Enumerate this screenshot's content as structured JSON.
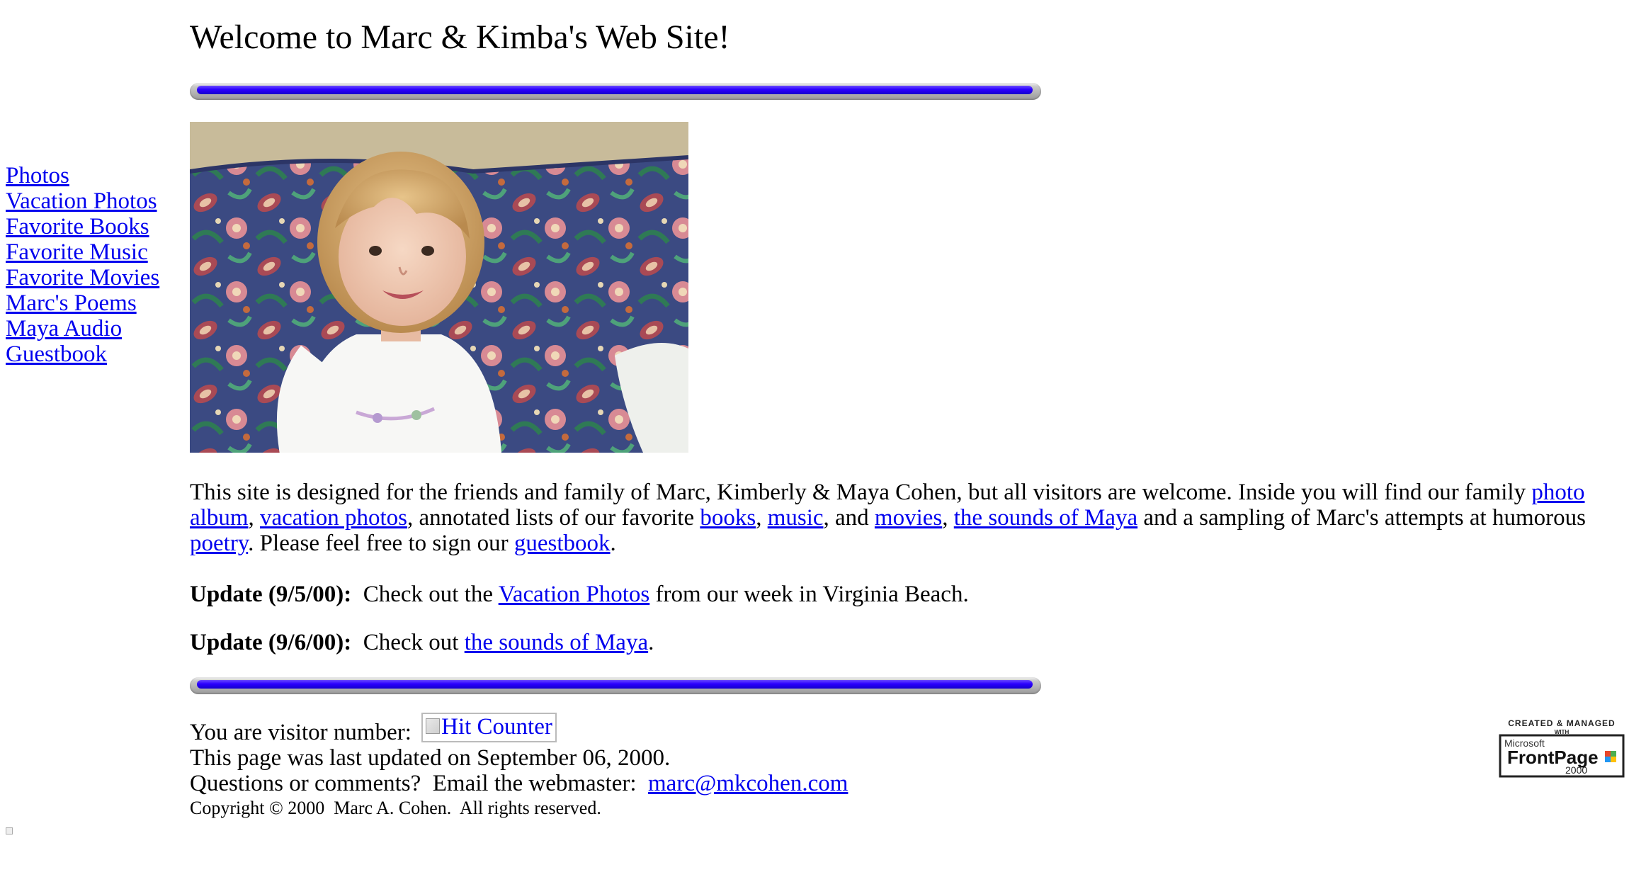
{
  "title": "Welcome to Marc & Kimba's Web Site!",
  "nav": {
    "items": [
      "Photos",
      "Vacation Photos",
      "Favorite Books",
      "Favorite Music",
      "Favorite Movies",
      "Marc's Poems",
      "Maya Audio",
      "Guestbook"
    ]
  },
  "intro": {
    "t1": "This site is designed for the friends and family of Marc, Kimberly & Maya Cohen, but all visitors are welcome.  Inside you will find our family ",
    "link_photo_album": "photo album",
    "t2": ", ",
    "link_vacation_photos": "vacation photos",
    "t3": ", annotated lists of our favorite ",
    "link_books": "books",
    "t4": ", ",
    "link_music": "music",
    "t5": ", and ",
    "link_movies": "movies",
    "t6": ", ",
    "link_sounds_of_maya": "the sounds of Maya",
    "t7": " and a sampling of Marc's attempts at humorous ",
    "link_poetry": "poetry",
    "t8": ".  Please feel free to sign our ",
    "link_guestbook": "guestbook",
    "t9": "."
  },
  "updates": [
    {
      "label": "Update (9/5/00):",
      "pre": "  Check out the ",
      "link": "Vacation Photos",
      "post": " from our week in Virginia Beach."
    },
    {
      "label": "Update (9/6/00):",
      "pre": "  Check out ",
      "link": "the sounds of Maya",
      "post": "."
    }
  ],
  "footer": {
    "visitor_label": "You are visitor number: ",
    "hit_counter_alt": "Hit Counter",
    "last_updated": "This page was last updated on September 06, 2000.",
    "questions": "Questions or comments?  Email the webmaster:  ",
    "email": "marc@mkcohen.com",
    "copyright": "Copyright © 2000  Marc A. Cohen.  All rights reserved."
  },
  "frontpage_badge": {
    "line1": "CREATED & MANAGED",
    "line2": "WITH",
    "microsoft": "Microsoft",
    "product": "FrontPage",
    "year": "2000"
  },
  "colors": {
    "link": "#0000ee",
    "bar_blue": "#2b00ff",
    "background": "#ffffff"
  },
  "icons": {
    "photo": "baby-photo",
    "hit_counter": "broken-image-icon",
    "frontpage": "frontpage-logo"
  }
}
